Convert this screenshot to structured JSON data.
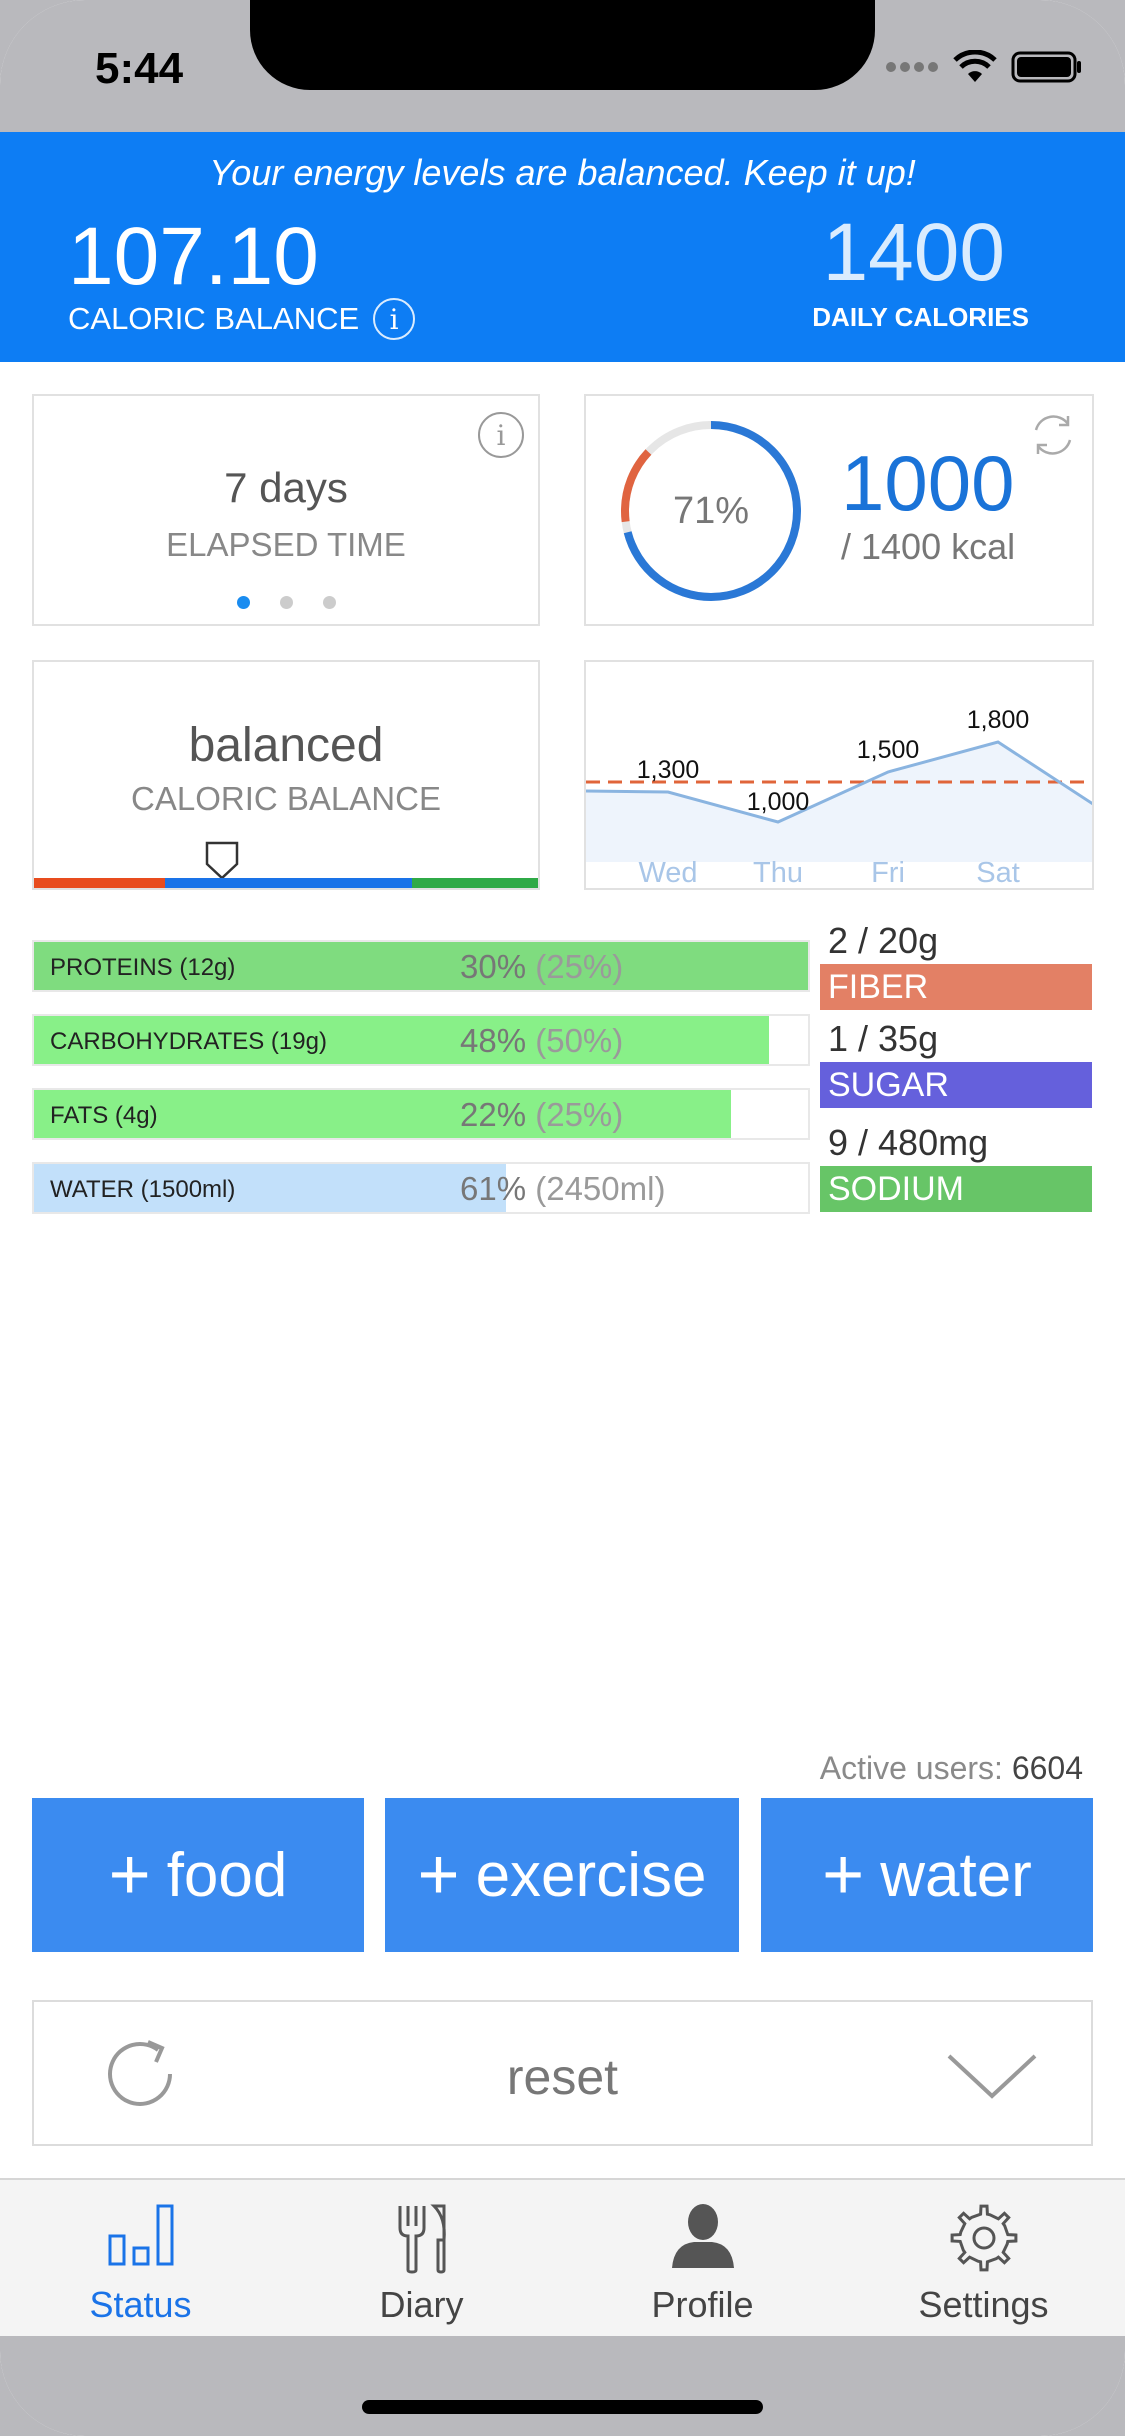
{
  "status_bar": {
    "time": "5:44"
  },
  "header": {
    "message": "Your energy levels are balanced. Keep it up!",
    "caloric_balance_value": "107.10",
    "caloric_balance_label": "CALORIC BALANCE",
    "info_glyph": "i",
    "daily_calories_value": "1400",
    "daily_calories_label": "DAILY CALORIES",
    "color": "#0d7df4"
  },
  "elapsed_card": {
    "value": "7 days",
    "label": "ELAPSED TIME",
    "info_glyph": "i",
    "page_dots": 3,
    "active_dot": 0
  },
  "intake_card": {
    "percent": "71%",
    "percent_value": 0.71,
    "consumed": "1000",
    "of_total": "/ 1400 kcal"
  },
  "balance_card": {
    "value": "balanced",
    "label": "CALORIC BALANCE",
    "scale_colors": [
      "#e84c1e",
      "#1a73e8",
      "#2faa47"
    ],
    "marker_position": 0.37
  },
  "chart_data": {
    "type": "line",
    "categories": [
      "Wed",
      "Thu",
      "Fri",
      "Sat"
    ],
    "x_labels_extended": [
      "",
      "Wed",
      "Thu",
      "Fri",
      "Sat",
      ""
    ],
    "values": [
      1300,
      1000,
      1500,
      1800
    ],
    "value_labels": [
      "1,300",
      "1,000",
      "1,500",
      "1,800"
    ],
    "reference_line": 1400,
    "ylim": [
      600,
      2400
    ],
    "line_color": "#8ab4e0",
    "reference_color": "#e0653a"
  },
  "macros": [
    {
      "name": "PROTEINS (12g)",
      "percent": "30%",
      "target": "(25%)",
      "fill": 1.0,
      "color": "#7fdc7f"
    },
    {
      "name": "CARBOHYDRATES (19g)",
      "percent": "48%",
      "target": "(50%)",
      "fill": 0.95,
      "color": "#88f088"
    },
    {
      "name": "FATS (4g)",
      "percent": "22%",
      "target": "(25%)",
      "fill": 0.9,
      "color": "#88f088"
    },
    {
      "name": "WATER (1500ml)",
      "percent": "61%",
      "target": "(2450ml)",
      "fill": 0.61,
      "color": "#c2e0fa"
    }
  ],
  "minerals": [
    {
      "amount": "2 / 20g",
      "label": "FIBER",
      "color": "#e38065"
    },
    {
      "amount": "1 / 35g",
      "label": "SUGAR",
      "color": "#6560dc"
    },
    {
      "amount": "9 / 480mg",
      "label": "SODIUM",
      "color": "#67c567"
    }
  ],
  "active_users": {
    "label": "Active users:",
    "count": "6604"
  },
  "actions": [
    {
      "plus": "+",
      "label": "food"
    },
    {
      "plus": "+",
      "label": "exercise"
    },
    {
      "plus": "+",
      "label": "water"
    }
  ],
  "reset": {
    "label": "reset"
  },
  "tabs": [
    {
      "label": "Status",
      "icon": "bar-chart-icon",
      "active": true
    },
    {
      "label": "Diary",
      "icon": "fork-knife-icon",
      "active": false
    },
    {
      "label": "Profile",
      "icon": "person-icon",
      "active": false
    },
    {
      "label": "Settings",
      "icon": "gear-icon",
      "active": false
    }
  ]
}
